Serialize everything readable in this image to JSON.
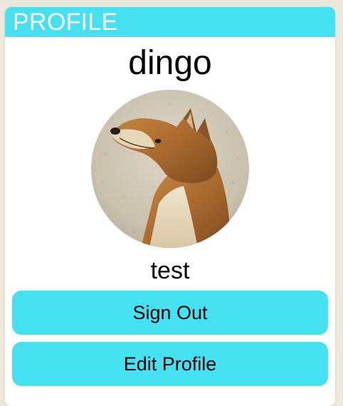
{
  "header": {
    "title": "PROFILE"
  },
  "profile": {
    "username": "dingo",
    "subtitle": "test",
    "avatar_icon": "dingo-photo"
  },
  "actions": {
    "sign_out_label": "Sign Out",
    "edit_profile_label": "Edit Profile"
  },
  "colors": {
    "accent": "#45e1f0",
    "header_text": "#ffffff",
    "page_background": "#ece9dc",
    "card_background": "#ffffff"
  }
}
